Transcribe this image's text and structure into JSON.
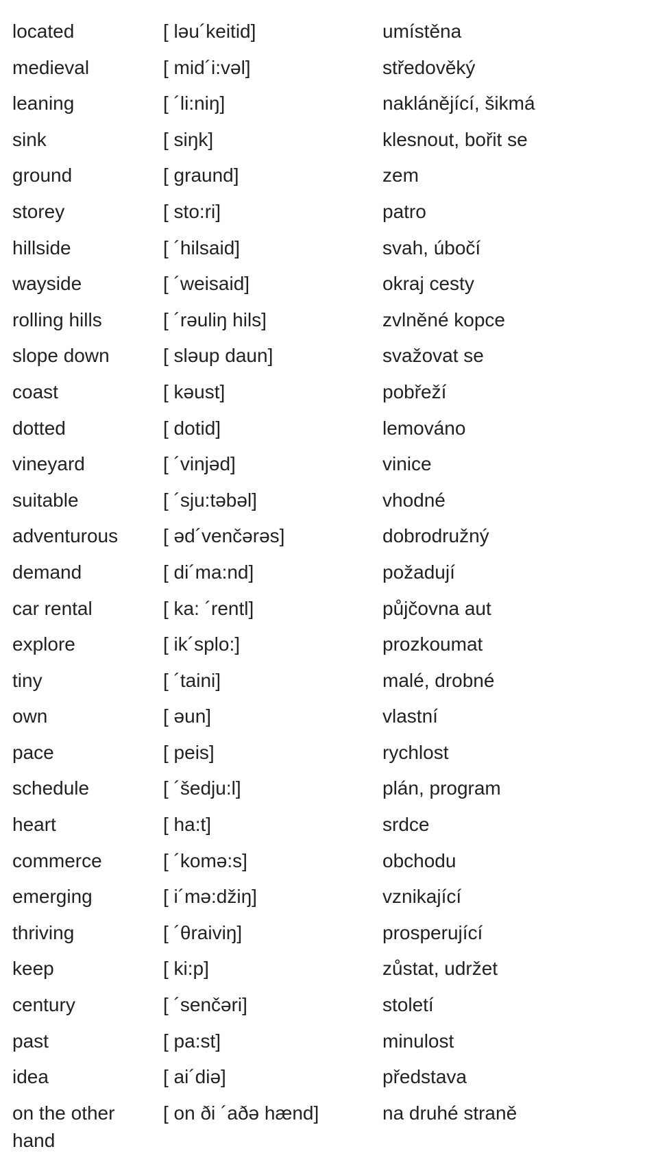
{
  "rows": [
    {
      "word": "located",
      "phonetic": "[ ləu´keitid]",
      "translation": "umístěna"
    },
    {
      "word": "medieval",
      "phonetic": "[ mid´i:vəl]",
      "translation": "středověký"
    },
    {
      "word": "leaning",
      "phonetic": "[ ´li:niŋ]",
      "translation": "naklánějící, šikmá"
    },
    {
      "word": "sink",
      "phonetic": "[ siŋk]",
      "translation": "klesnout, bořit se"
    },
    {
      "word": "ground",
      "phonetic": "[ graund]",
      "translation": "zem"
    },
    {
      "word": "storey",
      "phonetic": "[ sto:ri]",
      "translation": "patro"
    },
    {
      "word": "hillside",
      "phonetic": "[ ´hilsaid]",
      "translation": "svah, úbočí"
    },
    {
      "word": "wayside",
      "phonetic": "[ ´weisaid]",
      "translation": "okraj cesty"
    },
    {
      "word": "rolling hills",
      "phonetic": "[ ´rəuliŋ hils]",
      "translation": "zvlněné kopce"
    },
    {
      "word": "slope down",
      "phonetic": "[ sləup daun]",
      "translation": "svažovat se"
    },
    {
      "word": "coast",
      "phonetic": "[ kəust]",
      "translation": "pobřeží"
    },
    {
      "word": "dotted",
      "phonetic": "[ dotid]",
      "translation": "lemováno"
    },
    {
      "word": "vineyard",
      "phonetic": "[ ´vinjəd]",
      "translation": "vinice"
    },
    {
      "word": "suitable",
      "phonetic": "[ ´sju:təbəl]",
      "translation": "vhodné"
    },
    {
      "word": "adventurous",
      "phonetic": "[ əd´venčərəs]",
      "translation": "dobrodružný"
    },
    {
      "word": "demand",
      "phonetic": "[ di´ma:nd]",
      "translation": "požadují"
    },
    {
      "word": "car rental",
      "phonetic": "[ ka: ´rentl]",
      "translation": "půjčovna aut"
    },
    {
      "word": "explore",
      "phonetic": "[ ik´splo:]",
      "translation": "prozkoumat"
    },
    {
      "word": "tiny",
      "phonetic": "[ ´taini]",
      "translation": "malé, drobné"
    },
    {
      "word": "own",
      "phonetic": "[ əun]",
      "translation": "vlastní"
    },
    {
      "word": "pace",
      "phonetic": "[ peis]",
      "translation": "rychlost"
    },
    {
      "word": "schedule",
      "phonetic": "[ ´šedju:l]",
      "translation": "plán, program"
    },
    {
      "word": "heart",
      "phonetic": "[ ha:t]",
      "translation": "srdce"
    },
    {
      "word": "commerce",
      "phonetic": "[ ´komə:s]",
      "translation": "obchodu"
    },
    {
      "word": "emerging",
      "phonetic": "[ i´mə:džiŋ]",
      "translation": "vznikající"
    },
    {
      "word": "thriving",
      "phonetic": "[ ´θraiviŋ]",
      "translation": "prosperující"
    },
    {
      "word": "keep",
      "phonetic": "[ ki:p]",
      "translation": "zůstat, udržet"
    },
    {
      "word": "century",
      "phonetic": "[ ´senčəri]",
      "translation": "století"
    },
    {
      "word": "past",
      "phonetic": "[ pa:st]",
      "translation": "minulost"
    },
    {
      "word": "idea",
      "phonetic": "[ ai´diə]",
      "translation": "představa"
    },
    {
      "word": "on the other hand",
      "phonetic": "[ on ði ´aðə hænd]",
      "translation": "na druhé straně"
    }
  ]
}
